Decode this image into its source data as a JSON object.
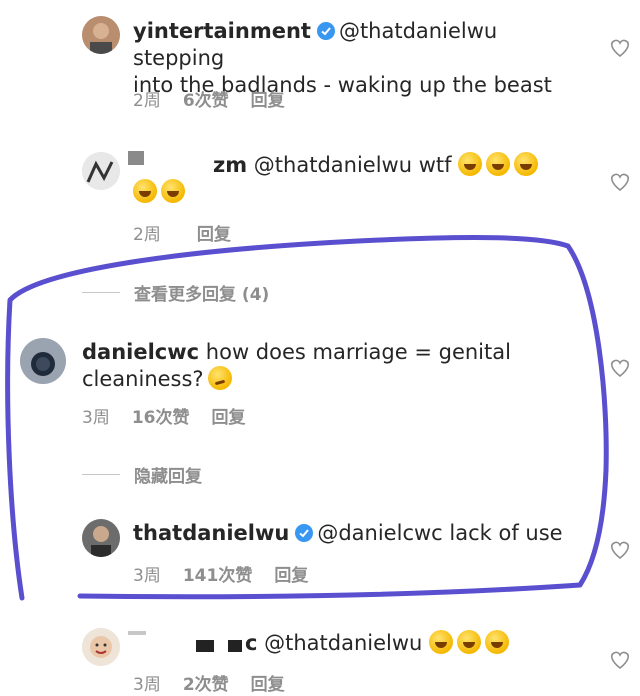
{
  "comments": [
    {
      "username": "yintertainment",
      "verified": true,
      "text_line1": "@thatdanielwu stepping",
      "text_line2": "into the badlands - waking up the beast",
      "time": "2周",
      "likes": "6次赞",
      "reply": "回复"
    },
    {
      "username": "zm",
      "verified": false,
      "text_line1": "@thatdanielwu wtf",
      "time": "2周",
      "likes": "",
      "reply": "回复"
    },
    {
      "username": "danielcwc",
      "verified": false,
      "text_line1": "how does marriage = genital",
      "text_line2": "cleaniness?",
      "time": "3周",
      "likes": "16次赞",
      "reply": "回复"
    },
    {
      "username": "thatdanielwu",
      "verified": true,
      "text_line1": "@danielcwc lack of use",
      "time": "3周",
      "likes": "141次赞",
      "reply": "回复"
    },
    {
      "username": "c",
      "verified": false,
      "text_line1": "@thatdanielwu",
      "time": "3周",
      "likes": "2次赞",
      "reply": "回复"
    }
  ],
  "view_more_replies": "查看更多回复 (4)",
  "hide_replies": "隐藏回复",
  "colors": {
    "highlight": "#5a4fcf",
    "meta": "#8e8e8e",
    "verified": "#3897f0"
  }
}
